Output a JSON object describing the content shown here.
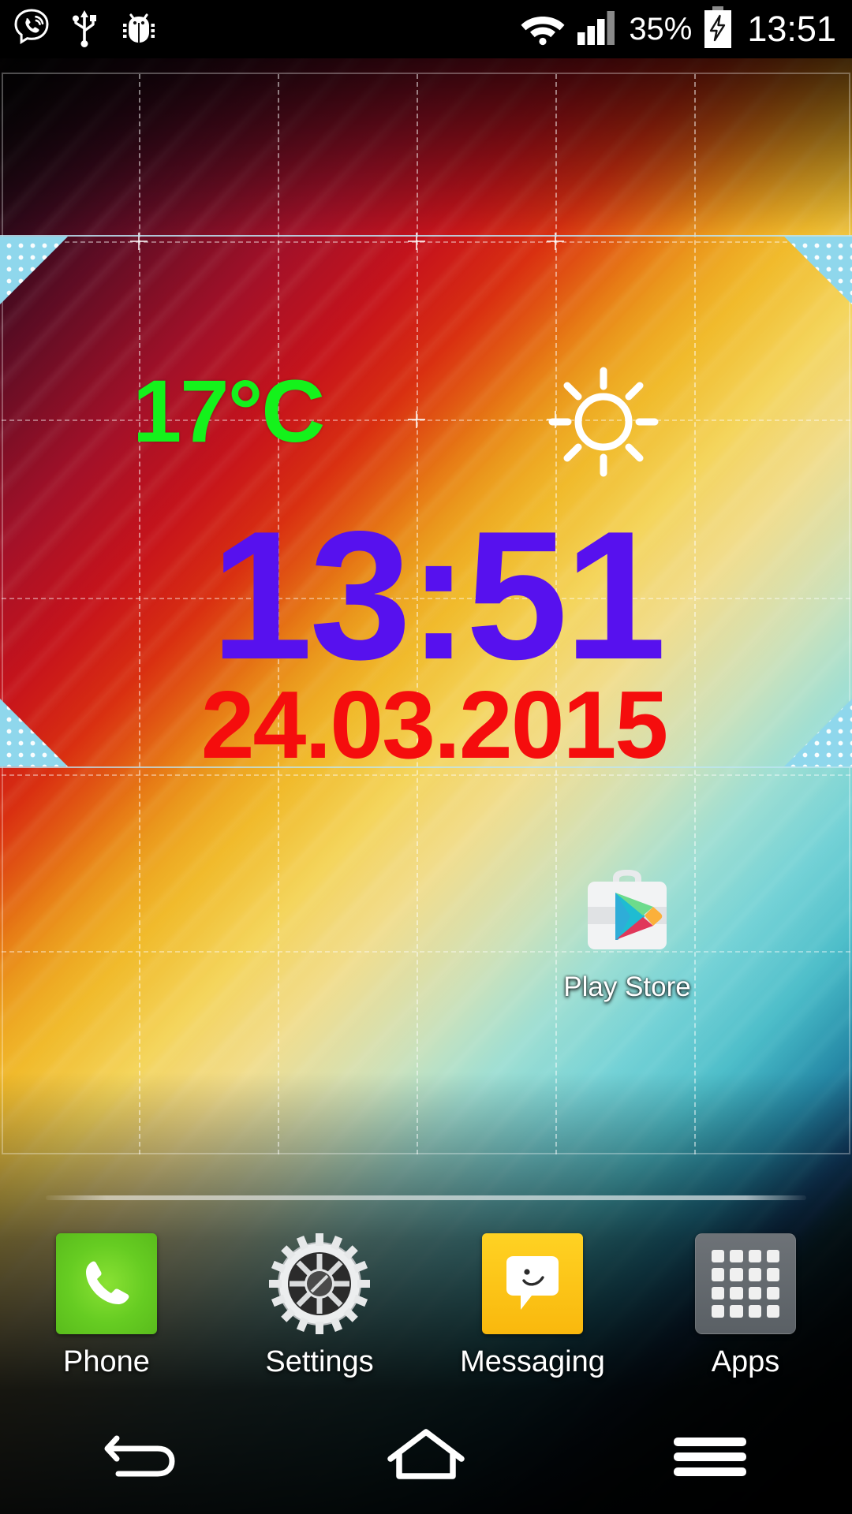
{
  "status_bar": {
    "left_icons": [
      {
        "name": "viber-icon",
        "label": "Viber"
      },
      {
        "name": "usb-icon",
        "label": "USB connected"
      },
      {
        "name": "bug-icon",
        "label": "USB debugging"
      }
    ],
    "wifi_icon": "wifi-icon",
    "signal_icon": "cellular-signal-icon",
    "signal_bars_filled": 3,
    "signal_bars_total": 4,
    "battery_percent": "35%",
    "battery_icon": "battery-charging-icon",
    "clock": "13:51"
  },
  "widget": {
    "name": "clock-weather-widget",
    "selected": true,
    "temperature": "17°C",
    "temperature_color": "#14F21B",
    "weather_icon": "sun-icon",
    "time": "13:51",
    "time_color": "#5711EE",
    "date": "24.03.2015",
    "date_color": "#F50D0D",
    "selection_handle_color": "#8FD7EC"
  },
  "home": {
    "shortcuts": [
      {
        "name": "play-store",
        "label": "Play Store",
        "icon": "play-store-icon"
      }
    ],
    "page_indicator": "current-page-bar"
  },
  "dock": {
    "items": [
      {
        "name": "phone",
        "label": "Phone",
        "icon": "phone-icon",
        "color": "#66CC22"
      },
      {
        "name": "settings",
        "label": "Settings",
        "icon": "gear-icon",
        "color": "#C9C9C9"
      },
      {
        "name": "messaging",
        "label": "Messaging",
        "icon": "message-bubble-icon",
        "color": "#FFC40D"
      },
      {
        "name": "apps",
        "label": "Apps",
        "icon": "app-drawer-grid-icon",
        "color": "#60666B"
      }
    ]
  },
  "nav_bar": {
    "back": {
      "name": "back-icon",
      "label": "Back"
    },
    "home": {
      "name": "home-icon",
      "label": "Home"
    },
    "menu": {
      "name": "menu-icon",
      "label": "Menu"
    }
  }
}
